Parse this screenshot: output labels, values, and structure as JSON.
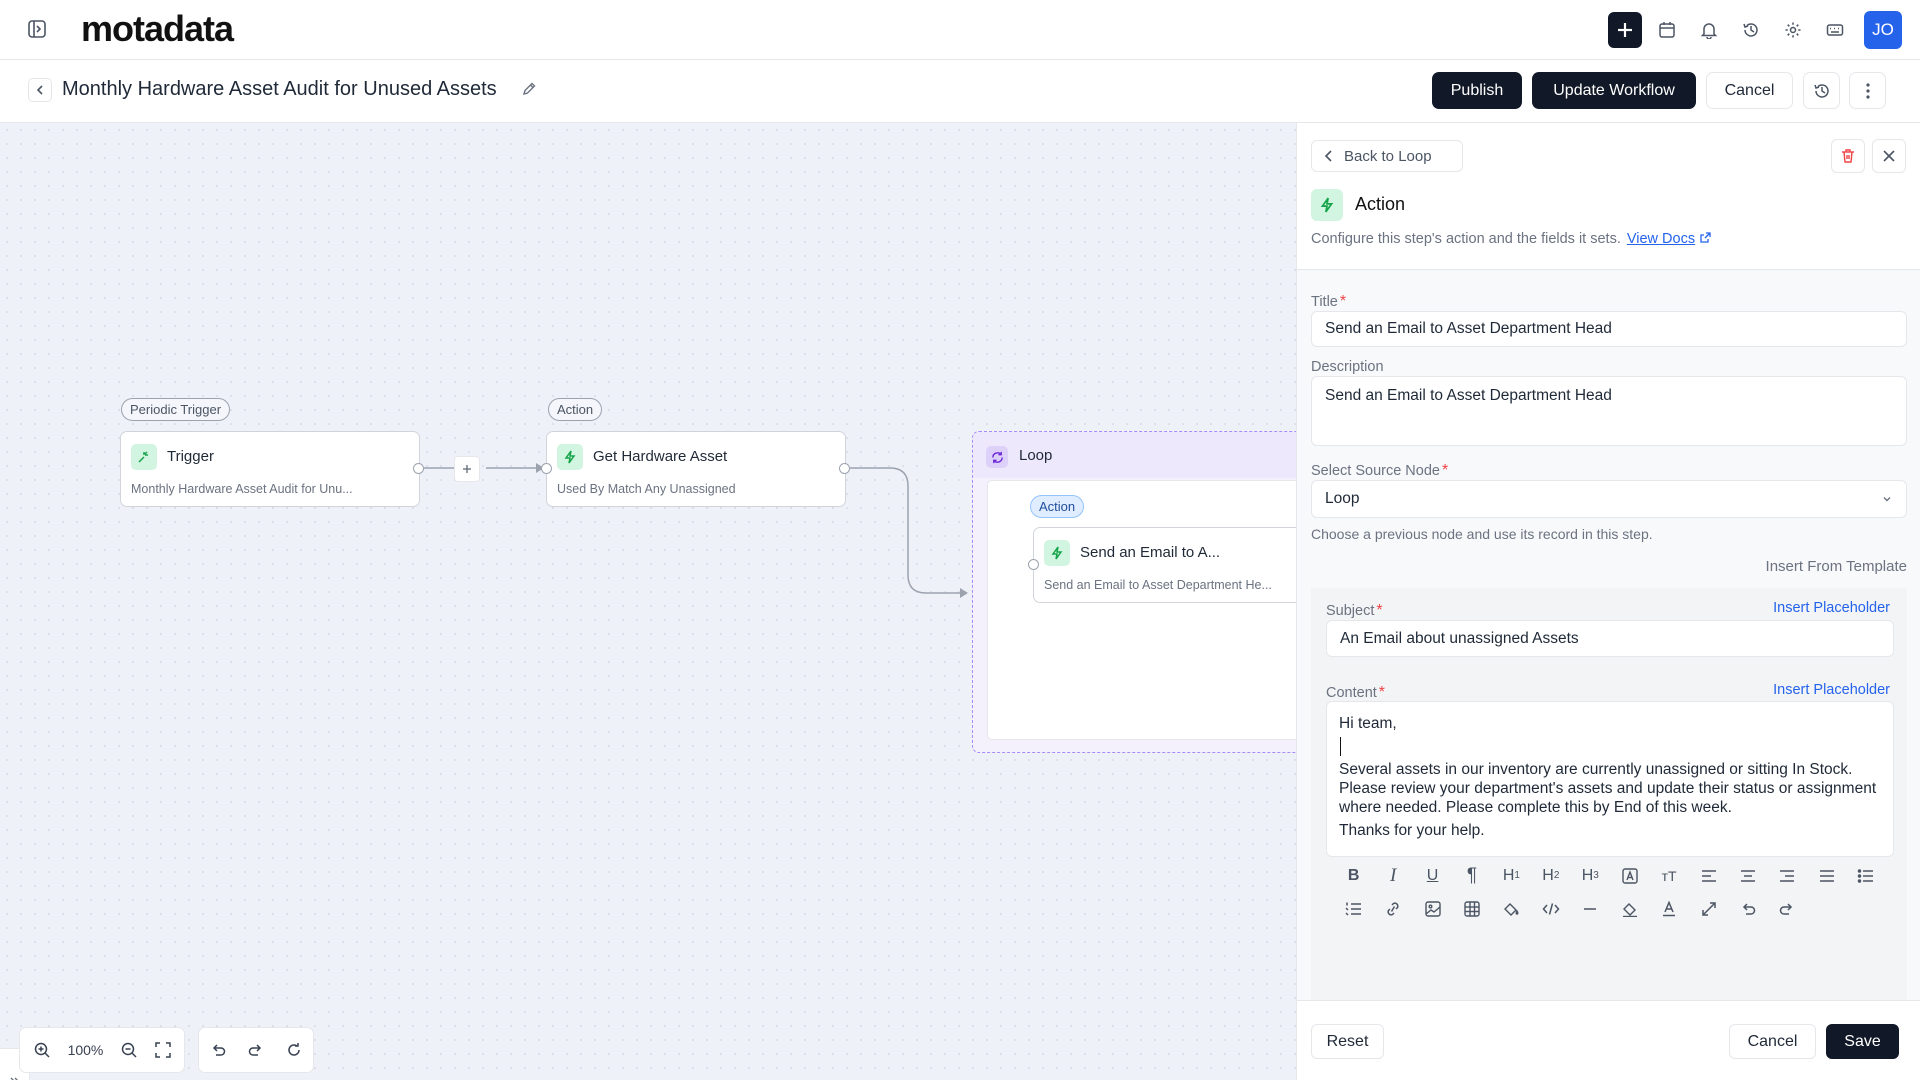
{
  "app": {
    "logo": "motadata",
    "avatar": "JO"
  },
  "header": {
    "title": "Monthly Hardware Asset Audit for Unused Assets",
    "publish": "Publish",
    "update": "Update Workflow",
    "cancel": "Cancel"
  },
  "canvas": {
    "trigger_pill": "Periodic Trigger",
    "trigger_title": "Trigger",
    "trigger_sub": "Monthly Hardware Asset Audit for Unu...",
    "action_pill": "Action",
    "action_title": "Get Hardware Asset",
    "action_sub": "Used By Match Any Unassigned",
    "loop_title": "Loop",
    "inner_pill": "Action",
    "inner_title": "Send an Email to A...",
    "inner_sub": "Send an Email to Asset Department He...",
    "zoom": "100%"
  },
  "panel": {
    "back": "Back to Loop",
    "heading": "Action",
    "description": "Configure this step's action and the fields it sets.",
    "docs_link": "View Docs",
    "title_label": "Title",
    "title_value": "Send an Email to Asset Department Head",
    "desc_label": "Description",
    "desc_value": "Send an Email to Asset Department Head",
    "source_label": "Select Source Node",
    "source_value": "Loop",
    "source_hint": "Choose a previous node and use its record in this step.",
    "insert_template": "Insert From Template",
    "subject_label": "Subject",
    "insert_placeholder": "Insert Placeholder",
    "subject_value": "An Email about unassigned Assets",
    "content_label": "Content",
    "content_line1": "Hi team,",
    "content_para": "Several assets in our inventory are currently unassigned or sitting In Stock. Please review your department's assets and update their status or assignment where needed. Please complete this by End of this week.",
    "content_thanks": "Thanks for your help.",
    "reset": "Reset",
    "cancel": "Cancel",
    "save": "Save"
  },
  "colors": {
    "accent": "#2563eb",
    "dark": "#111827",
    "required": "#ef4444",
    "loop": "#a78bfa"
  }
}
